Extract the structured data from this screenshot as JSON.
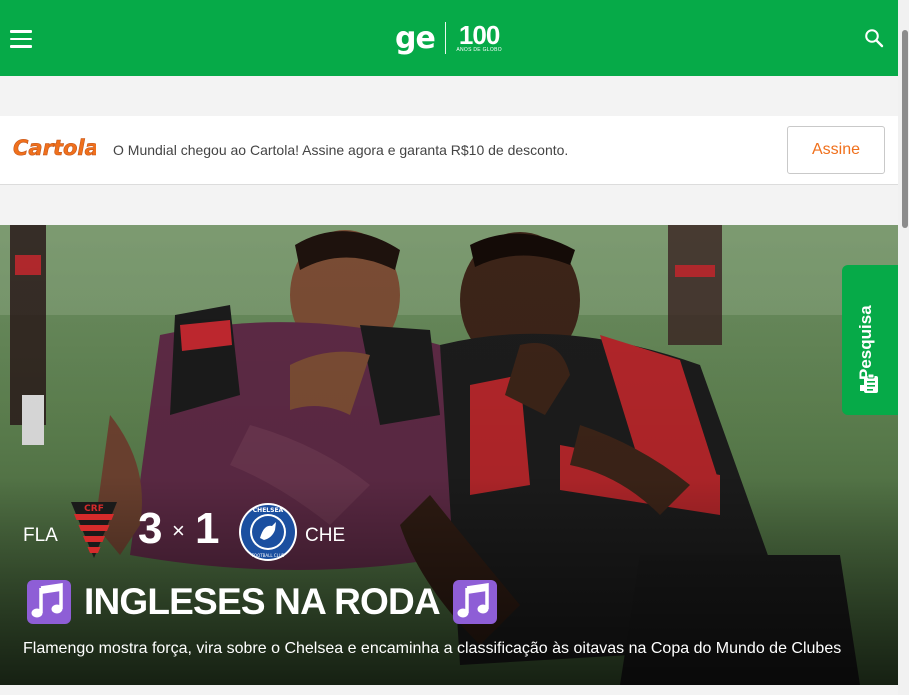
{
  "header": {
    "logo_text": "ge",
    "anniversary_number": "100",
    "anniversary_caption": "ANOS DE GLOBO",
    "menu_icon": "hamburger-menu-icon",
    "search_icon": "search-icon",
    "brand_color": "#06aa48"
  },
  "promo": {
    "brand": "Cartola",
    "brand_color": "#f0701c",
    "text": "O Mundial chegou ao Cartola! Assine agora e garanta R$10 de desconto.",
    "button_label": "Assine"
  },
  "match": {
    "home_abbr": "FLA",
    "home_score": "3",
    "separator": "×",
    "away_score": "1",
    "away_abbr": "CHE",
    "home_crest": "flamengo-crest-icon",
    "away_crest": "chelsea-crest-icon"
  },
  "headline": {
    "title": "INGLESES NA RODA",
    "leading_icon": "music-note-icon",
    "trailing_icon": "music-note-icon",
    "summary": "Flamengo mostra força, vira sobre o Chelsea e encaminha a classificação às oitavas na Copa do Mundo de Clubes"
  },
  "survey": {
    "label": "Pesquisa",
    "icon": "survey-clipboard-icon"
  }
}
